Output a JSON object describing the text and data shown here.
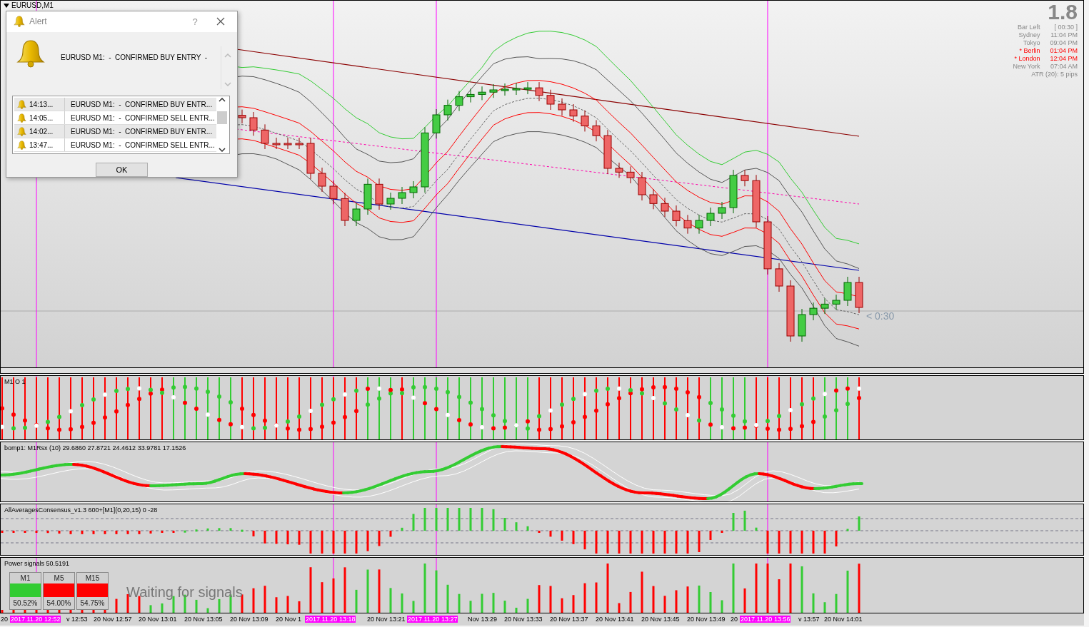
{
  "chart": {
    "symbol": "EURUSD,M1",
    "countdown": "< 0:30",
    "info": {
      "value": "1.8",
      "rows": [
        {
          "label": "Bar Left",
          "value": "[ 00:30 ]",
          "highlight": false
        },
        {
          "label": "Sydney",
          "value": "11:04 PM",
          "highlight": false
        },
        {
          "label": "Tokyo",
          "value": "09:04 PM",
          "highlight": false
        },
        {
          "label": "* Berlin",
          "value": "01:04 PM",
          "highlight": true
        },
        {
          "label": "* London",
          "value": "12:04 PM",
          "highlight": true
        },
        {
          "label": "New York",
          "value": "07:04 AM",
          "highlight": false
        }
      ],
      "atr": "ATR (20): 5 pips"
    }
  },
  "alert": {
    "title": "Alert",
    "help": "?",
    "message": "EURUSD M1:  -  CONFIRMED BUY ENTRY  -",
    "history": [
      {
        "time": "14:13...",
        "message": "EURUSD M1:  -  CONFIRMED BUY ENTR..."
      },
      {
        "time": "14:05...",
        "message": "EURUSD M1:  -  CONFIRMED SELL ENTR..."
      },
      {
        "time": "14:02...",
        "message": "EURUSD M1:  -  CONFIRMED BUY ENTR..."
      },
      {
        "time": "13:47...",
        "message": "EURUSD M1:  -  CONFIRMED SELL ENTR..."
      }
    ],
    "ok": "OK"
  },
  "indicators": [
    {
      "kind": "dots",
      "label": "M1 O 1"
    },
    {
      "kind": "rsx",
      "label": "bomp1: M1Rsx (10) 29.6860 27.8721 24.4612 33.9781 17.1526"
    },
    {
      "kind": "consensus",
      "label": "AllAveragesConsensus_v1.3 600+[M1](0,20,15) 0 -28"
    },
    {
      "kind": "power",
      "label": "Power signals 50.5191",
      "tiles": [
        {
          "label": "M1",
          "color": "#33cc33",
          "value": "50.52%"
        },
        {
          "label": "M5",
          "color": "#ff0000",
          "value": "54.00%"
        },
        {
          "label": "M15",
          "color": "#ff0000",
          "value": "54.75%"
        }
      ],
      "status": "Waiting for signals"
    }
  ],
  "time_axis": [
    {
      "label": "20",
      "highlight": false
    },
    {
      "label": "2017.11.20 12:52",
      "highlight": true
    },
    {
      "label": "v 12:53",
      "highlight": false
    },
    {
      "label": "20 Nov 12:57",
      "highlight": false
    },
    {
      "label": "20 Nov 13:01",
      "highlight": false
    },
    {
      "label": "20 Nov 13:05",
      "highlight": false
    },
    {
      "label": "20 Nov 13:09",
      "highlight": false
    },
    {
      "label": "20 Nov 1",
      "highlight": false
    },
    {
      "label": "2017.11.20 13:18",
      "highlight": true
    },
    {
      "label": "20 Nov 13:21",
      "highlight": false
    },
    {
      "label": "2017.11.20 13:27",
      "highlight": true
    },
    {
      "label": "Nov 13:29",
      "highlight": false
    },
    {
      "label": "20 Nov 13:33",
      "highlight": false
    },
    {
      "label": "20 Nov 13:37",
      "highlight": false
    },
    {
      "label": "20 Nov 13:41",
      "highlight": false
    },
    {
      "label": "20 Nov 13:45",
      "highlight": false
    },
    {
      "label": "20 Nov 13:49",
      "highlight": false
    },
    {
      "label": "20",
      "highlight": false
    },
    {
      "label": "2017.11.20 13:56",
      "highlight": true
    },
    {
      "label": "v 13:57",
      "highlight": false
    },
    {
      "label": "20 Nov 14:01",
      "highlight": false
    }
  ]
}
